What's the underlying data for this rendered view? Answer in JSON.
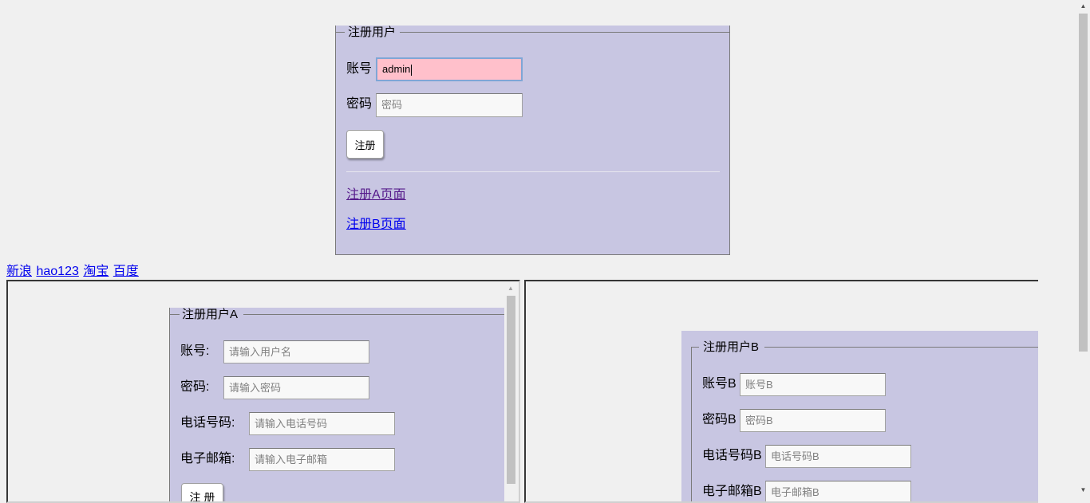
{
  "top_form": {
    "legend": "注册用户",
    "account_label": "账号",
    "account_value": "admin",
    "password_label": "密码",
    "password_placeholder": "密码",
    "submit_label": "注册",
    "link_a": "注册A页面",
    "link_b": "注册B页面"
  },
  "link_row": {
    "links": [
      "新浪",
      "hao123",
      "淘宝",
      "百度"
    ]
  },
  "iframe_a": {
    "legend": "注册用户A",
    "account_label": "账号:",
    "account_placeholder": "请输入用户名",
    "password_label": "密码:",
    "password_placeholder": "请输入密码",
    "phone_label": "电话号码:",
    "phone_placeholder": "请输入电话号码",
    "email_label": "电子邮箱:",
    "email_placeholder": "请输入电子邮箱",
    "submit_label": "注 册"
  },
  "iframe_b": {
    "legend": "注册用户B",
    "account_label": "账号B",
    "account_placeholder": "账号B",
    "password_label": "密码B",
    "password_placeholder": "密码B",
    "phone_label": "电话号码B",
    "phone_placeholder": "电话号码B",
    "email_label": "电子邮箱B",
    "email_placeholder": "电子邮箱B"
  },
  "colors": {
    "panel_bg": "#c8c6e2",
    "active_input_bg": "#ffc0cb",
    "page_bg": "#f0f0f0",
    "link": "#0000ee",
    "visited_link": "#551a8b"
  },
  "icons": {
    "scroll_up": "scroll-up-arrow-icon",
    "scroll_down": "scroll-down-arrow-icon"
  }
}
